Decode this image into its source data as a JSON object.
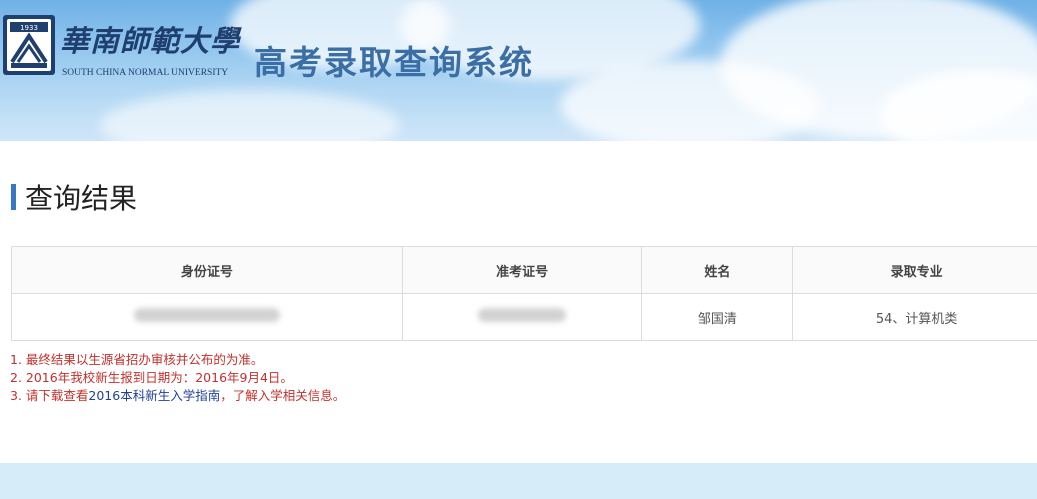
{
  "header": {
    "university_name_cn": "華南師範大學",
    "university_name_en": "SOUTH CHINA NORMAL UNIVERSITY",
    "system_title": "高考录取查询系统",
    "logo_icon": "university-seal-icon",
    "seal_year": "1933"
  },
  "section": {
    "title": "查询结果"
  },
  "table": {
    "headers": [
      "身份证号",
      "准考证号",
      "姓名",
      "录取专业"
    ],
    "row": {
      "id_number": "",
      "exam_number": "",
      "name": "邹国清",
      "major": "54、计算机类"
    }
  },
  "notes": {
    "line1": "1. 最终结果以生源省招办审核并公布的为准。",
    "line2": "2. 2016年我校新生报到日期为：2016年9月4日。",
    "line3_prefix": "3. 请下载查看",
    "line3_link": "2016本科新生入学指南",
    "line3_suffix": "，了解入学相关信息。"
  },
  "colors": {
    "accent": "#3876c6",
    "title": "#3a6ea5",
    "note": "#c4302b",
    "link": "#1f3f9a"
  }
}
